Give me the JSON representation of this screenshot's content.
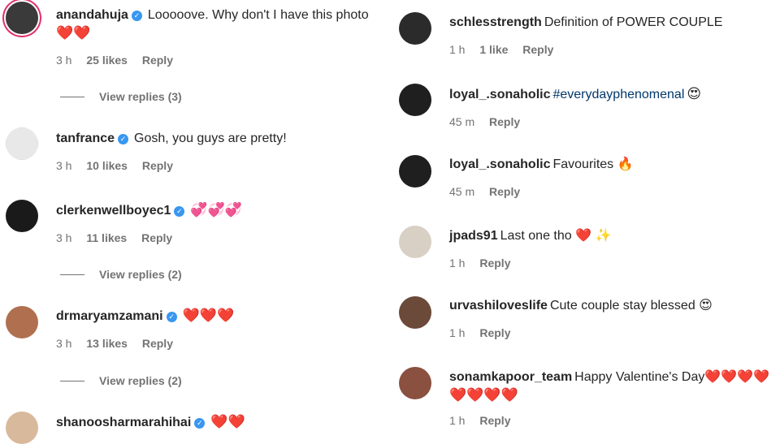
{
  "left": {
    "comments": [
      {
        "username": "anandahuja",
        "verified": true,
        "text": "Looooove. Why don't I have this photo",
        "emoji": "❤️❤️",
        "time": "3 h",
        "likes": "25 likes",
        "reply": "Reply",
        "view_replies": "View replies (3)"
      },
      {
        "username": "tanfrance",
        "verified": true,
        "text": "Gosh, you guys are pretty!",
        "time": "3 h",
        "likes": "10 likes",
        "reply": "Reply"
      },
      {
        "username": "clerkenwellboyec1",
        "verified": true,
        "text": "💞💞💞",
        "time": "3 h",
        "likes": "11 likes",
        "reply": "Reply",
        "view_replies": "View replies (2)"
      },
      {
        "username": "drmaryamzamani",
        "verified": true,
        "text": "❤️❤️❤️",
        "time": "3 h",
        "likes": "13 likes",
        "reply": "Reply",
        "view_replies": "View replies (2)"
      },
      {
        "username": "shanoosharmarahihai",
        "verified": true,
        "text": "❤️❤️"
      }
    ]
  },
  "right": {
    "comments": [
      {
        "username": "schlesstrength",
        "text": "Definition of POWER COUPLE",
        "time": "1 h",
        "likes": "1 like",
        "reply": "Reply"
      },
      {
        "username": "loyal_.sonaholic",
        "hashtag": "#everydayphenomenal",
        "text": "😍",
        "time": "45 m",
        "reply": "Reply"
      },
      {
        "username": "loyal_.sonaholic",
        "text": "Favourites 🔥",
        "time": "45 m",
        "reply": "Reply"
      },
      {
        "username": "jpads91",
        "text": "Last one tho ❤️ ✨",
        "time": "1 h",
        "reply": "Reply"
      },
      {
        "username": "urvashiloveslife",
        "text": "Cute couple stay blessed 😍",
        "time": "1 h",
        "reply": "Reply"
      },
      {
        "username": "sonamkapoor_team",
        "text": "Happy Valentine's Day❤️❤️❤️❤️",
        "text2": "❤️❤️❤️❤️",
        "time": "1 h",
        "reply": "Reply"
      }
    ]
  },
  "avatar_colors": [
    "#3a3a3a",
    "#e8e8e8",
    "#1a1a1a",
    "#b07050",
    "#d9b99b",
    "#2b2b2b",
    "#1f1f1f",
    "#1f1f1f",
    "#d8d0c4",
    "#6b4a3a",
    "#8a5040"
  ],
  "verified_color": "#3897f0",
  "accent": "#e1306c"
}
